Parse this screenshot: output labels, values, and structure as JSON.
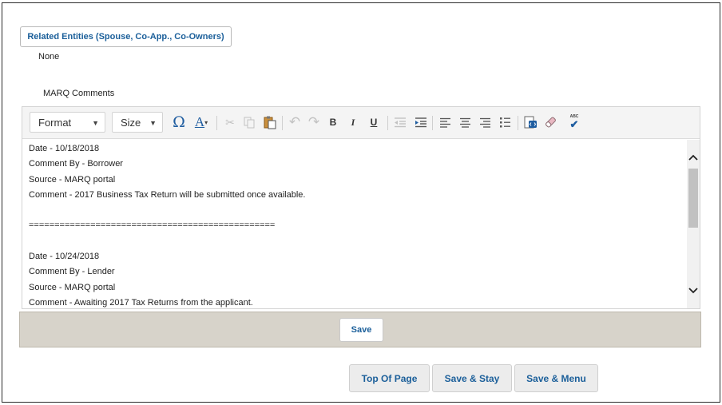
{
  "related_entities": {
    "button_label": "Related Entities (Spouse, Co-App., Co-Owners)",
    "value": "None"
  },
  "comments": {
    "label": "MARQ Comments",
    "toolbar": {
      "format_label": "Format",
      "size_label": "Size",
      "bold_glyph": "B",
      "italic_glyph": "I",
      "underline_glyph": "U",
      "spellcheck_glyph": "ABC"
    },
    "lines": [
      "Date - 10/18/2018",
      "Comment By - Borrower",
      "Source - MARQ portal",
      "Comment - 2017 Business Tax Return will be submitted once available.",
      "",
      "================================================",
      "",
      "Date - 10/24/2018",
      "Comment By - Lender",
      "Source - MARQ portal",
      "Comment - Awaiting 2017 Tax Returns from the applicant."
    ]
  },
  "save_bar": {
    "save_label": "Save"
  },
  "footer": {
    "top_of_page_label": "Top Of Page",
    "save_stay_label": "Save & Stay",
    "save_menu_label": "Save & Menu"
  },
  "colors": {
    "link_blue": "#1b5f9a",
    "save_bar_bg": "#d7d3ca",
    "toolbar_bg": "#f4f4f4"
  }
}
